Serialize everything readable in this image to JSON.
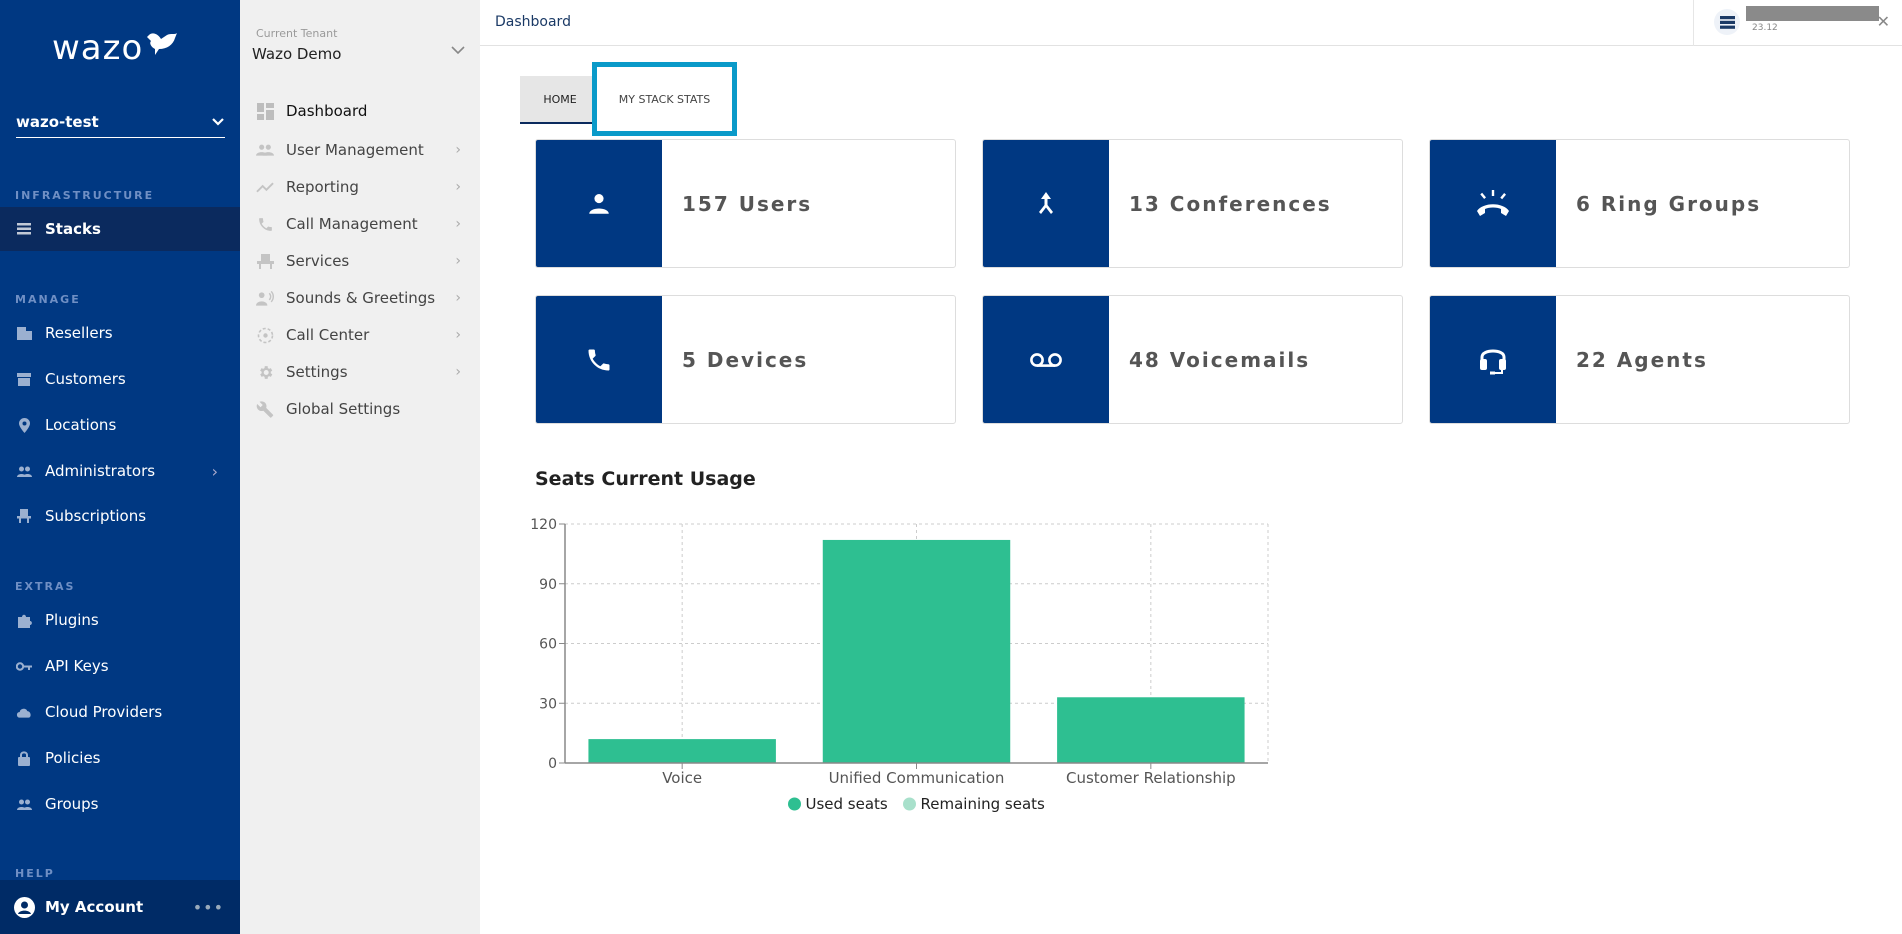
{
  "sidebar": {
    "logo_text": "wazo",
    "stack_select": "wazo-test",
    "sections": {
      "infrastructure": "INFRASTRUCTURE",
      "manage": "MANAGE",
      "extras": "EXTRAS",
      "help": "HELP"
    },
    "items": {
      "stacks": "Stacks",
      "resellers": "Resellers",
      "customers": "Customers",
      "locations": "Locations",
      "administrators": "Administrators",
      "subscriptions": "Subscriptions",
      "plugins": "Plugins",
      "api_keys": "API Keys",
      "cloud_providers": "Cloud Providers",
      "policies": "Policies",
      "groups": "Groups"
    },
    "account": "My Account",
    "account_more": "•••"
  },
  "tenant": {
    "label": "Current Tenant",
    "name": "Wazo Demo",
    "items": [
      {
        "label": "Dashboard",
        "icon": "dashboard-icon",
        "has_children": false
      },
      {
        "label": "User Management",
        "icon": "users-icon",
        "has_children": true
      },
      {
        "label": "Reporting",
        "icon": "trending-icon",
        "has_children": true
      },
      {
        "label": "Call Management",
        "icon": "phone-icon",
        "has_children": true
      },
      {
        "label": "Services",
        "icon": "services-icon",
        "has_children": true
      },
      {
        "label": "Sounds & Greetings",
        "icon": "sounds-icon",
        "has_children": true
      },
      {
        "label": "Call Center",
        "icon": "call-center-icon",
        "has_children": true
      },
      {
        "label": "Settings",
        "icon": "gear-icon",
        "has_children": true
      },
      {
        "label": "Global Settings",
        "icon": "wrench-icon",
        "has_children": false
      }
    ]
  },
  "header": {
    "breadcrumb": "Dashboard",
    "notification_version": "23.12",
    "close": "✕"
  },
  "tabs": {
    "home": "HOME",
    "stats": "MY STACK STATS"
  },
  "cards": [
    {
      "label": "157 Users",
      "icon": "user-icon"
    },
    {
      "label": "13 Conferences",
      "icon": "merge-icon"
    },
    {
      "label": "6 Ring Groups",
      "icon": "ring-phone-icon"
    },
    {
      "label": "5 Devices",
      "icon": "phone-icon"
    },
    {
      "label": "48 Voicemails",
      "icon": "voicemail-icon"
    },
    {
      "label": "22 Agents",
      "icon": "headset-icon"
    }
  ],
  "colors": {
    "brand": "#003882",
    "used": "#2ebf91",
    "remaining": "#a8e0cb",
    "highlight": "#0a9ac9"
  },
  "chart_data": {
    "type": "bar",
    "title": "Seats Current Usage",
    "categories": [
      "Voice",
      "Unified Communication",
      "Customer Relationship"
    ],
    "series": [
      {
        "name": "Used seats",
        "values": [
          12,
          112,
          33
        ]
      },
      {
        "name": "Remaining seats",
        "values": [
          0,
          0,
          0
        ]
      }
    ],
    "yticks": [
      0,
      30,
      60,
      90,
      120
    ],
    "ylim": [
      0,
      120
    ],
    "xlabel": "",
    "ylabel": "",
    "grid": true,
    "legend": "bottom"
  }
}
